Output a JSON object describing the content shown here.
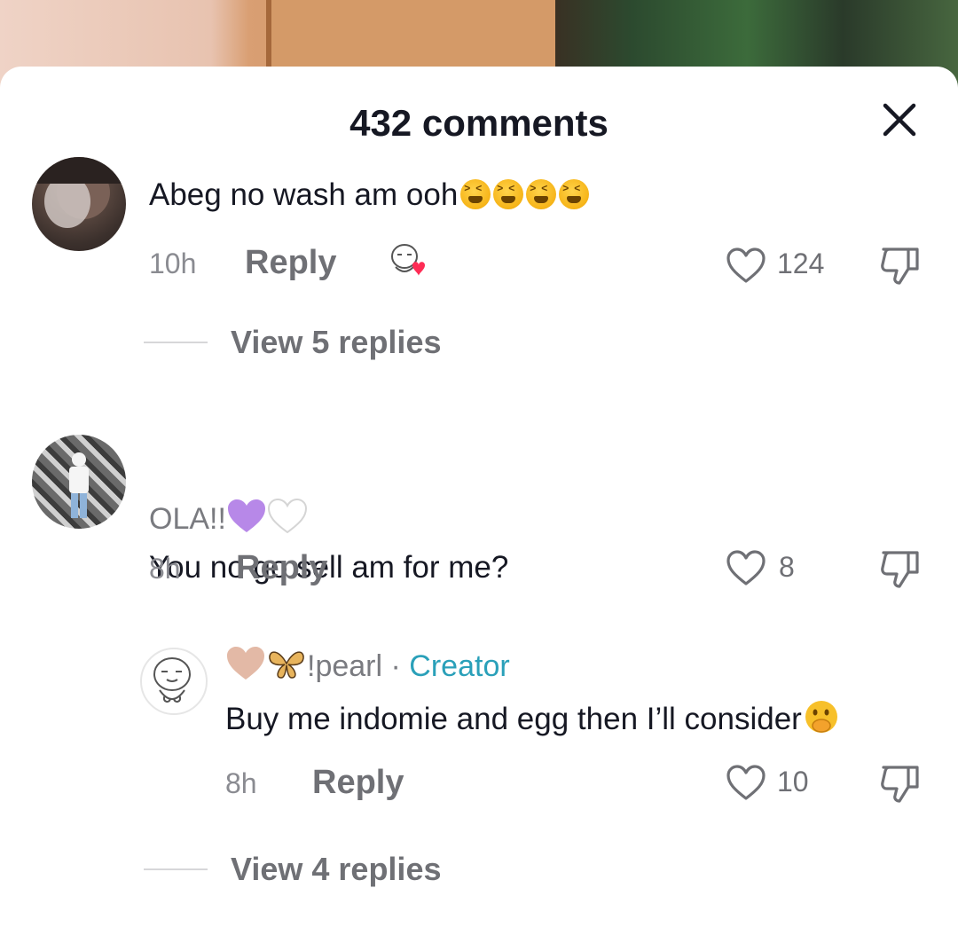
{
  "header": {
    "title": "432 comments",
    "close_icon": "close-icon"
  },
  "comments": [
    {
      "text": "Abeg no wash am ooh",
      "text_emoji": "tired-face-emoji ×4",
      "time": "10h",
      "reply_label": "Reply",
      "sticker": "creator-liked-icon",
      "likes": "124",
      "view_replies": "View 5 replies"
    },
    {
      "username": "OLA!!",
      "username_emoji": "purple-heart, white-heart",
      "text": "You no go sell am for me?",
      "time": "8h",
      "reply_label": "Reply",
      "likes": "8"
    },
    {
      "username": "!pearl",
      "username_prefix_emoji": "light-brown-heart, butterfly",
      "separator": "·",
      "creator_label": "Creator",
      "text": "Buy me indomie and egg then I’ll consider",
      "text_emoji": "face-with-hand-over-mouth-emoji",
      "time": "8h",
      "reply_label": "Reply",
      "likes": "10",
      "view_replies": "View 4 replies"
    }
  ],
  "colors": {
    "text_primary": "#161823",
    "text_secondary": "#6f7075",
    "creator": "#2aa0b9",
    "like_heart": "#fe2c55"
  }
}
